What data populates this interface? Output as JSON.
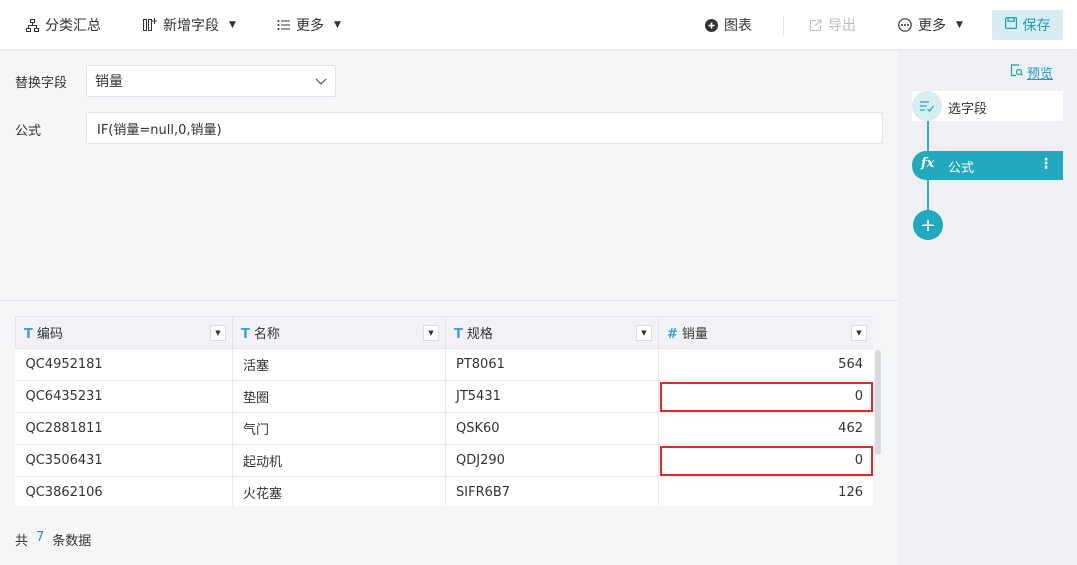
{
  "toolbar": {
    "summary_label": "分类汇总",
    "add_field_label": "新增字段",
    "more_left_label": "更多",
    "chart_label": "图表",
    "export_label": "导出",
    "more_right_label": "更多",
    "save_label": "保存"
  },
  "config": {
    "replace_field_label": "替换字段",
    "replace_field_value": "销量",
    "formula_label": "公式",
    "formula_value": "IF(销量=null,0,销量)"
  },
  "steps": {
    "preview_label": "预览",
    "step1_label": "选字段",
    "step2_label": "公式",
    "step2_icon": "fx"
  },
  "table": {
    "columns": [
      {
        "type": "T",
        "name": "编码"
      },
      {
        "type": "T",
        "name": "名称"
      },
      {
        "type": "T",
        "name": "规格"
      },
      {
        "type": "#",
        "name": "销量"
      }
    ],
    "rows": [
      [
        "QC4952181",
        "活塞",
        "PT8061",
        "564"
      ],
      [
        "QC6435231",
        "垫圈",
        "JT5431",
        "0"
      ],
      [
        "QC2881811",
        "气门",
        "QSK60",
        "462"
      ],
      [
        "QC3506431",
        "起动机",
        "QDJ290",
        "0"
      ],
      [
        "QC3862106",
        "火花塞",
        "SIFR6B7",
        "126"
      ]
    ],
    "highlighted_rows": [
      1,
      3
    ]
  },
  "footer": {
    "prefix": "共",
    "count": "7",
    "suffix": "条数据"
  },
  "colors": {
    "accent": "#22a9bd",
    "highlight": "#e02a2a"
  }
}
